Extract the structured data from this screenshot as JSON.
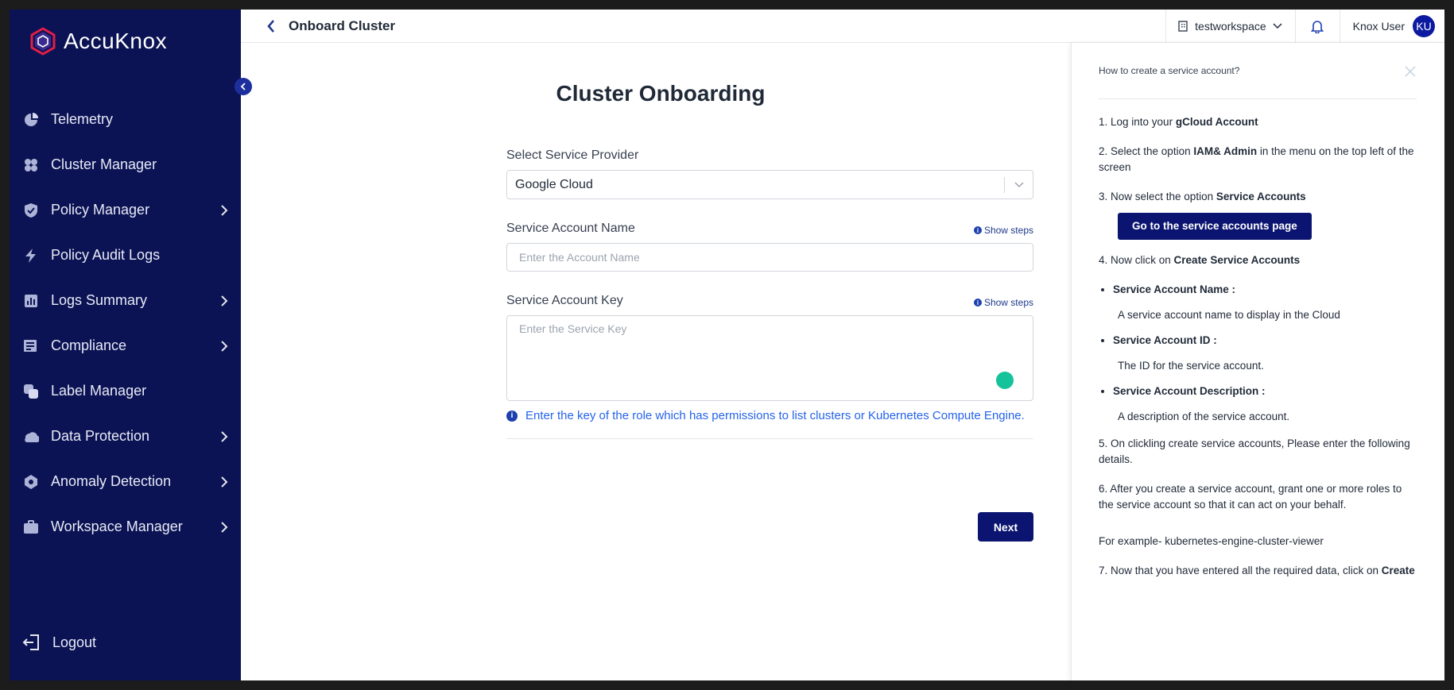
{
  "brand": {
    "name": "AccuKnox"
  },
  "sidebar": {
    "items": [
      {
        "label": "Telemetry",
        "icon": "telemetry-icon",
        "has_children": false
      },
      {
        "label": "Cluster Manager",
        "icon": "cluster-icon",
        "has_children": false
      },
      {
        "label": "Policy Manager",
        "icon": "shield-icon",
        "has_children": true
      },
      {
        "label": "Policy Audit Logs",
        "icon": "bolt-icon",
        "has_children": false
      },
      {
        "label": "Logs Summary",
        "icon": "bar-chart-icon",
        "has_children": true
      },
      {
        "label": "Compliance",
        "icon": "list-check-icon",
        "has_children": true
      },
      {
        "label": "Label Manager",
        "icon": "label-icon",
        "has_children": false
      },
      {
        "label": "Data Protection",
        "icon": "data-protection-icon",
        "has_children": true
      },
      {
        "label": "Anomaly Detection",
        "icon": "anomaly-icon",
        "has_children": true
      },
      {
        "label": "Workspace Manager",
        "icon": "briefcase-icon",
        "has_children": true
      }
    ],
    "logout_label": "Logout"
  },
  "header": {
    "title": "Onboard Cluster",
    "workspace": "testworkspace",
    "user_name": "Knox User",
    "user_initials": "KU"
  },
  "main": {
    "title": "Cluster Onboarding",
    "provider_label": "Select Service Provider",
    "provider_value": "Google Cloud",
    "account_name_label": "Service Account Name",
    "account_name_placeholder": "Enter the Account Name",
    "account_key_label": "Service Account Key",
    "account_key_placeholder": "Enter the Service Key",
    "show_steps": "Show steps",
    "hint": "Enter the key of the role which has permissions to list clusters or Kubernetes Compute Engine.",
    "next_label": "Next"
  },
  "help": {
    "title": "How to create a service account?",
    "step1_pre": "1. Log into your ",
    "step1_bold": "gCloud Account",
    "step2_pre": "2. Select the option ",
    "step2_bold": "IAM& Admin",
    "step2_post": " in the menu on the top left of the screen",
    "step3_pre": "3. Now select the option ",
    "step3_bold": "Service Accounts",
    "goto_button": "Go to the service accounts page",
    "step4_pre": "4. Now click on ",
    "step4_bold": "Create Service Accounts",
    "bullets": [
      {
        "title": "Service Account Name :",
        "desc": "A service account name to display in the Cloud"
      },
      {
        "title": "Service Account ID :",
        "desc": "The ID for the service account."
      },
      {
        "title": "Service Account Description :",
        "desc": "A description of the service account."
      }
    ],
    "step5": "5. On clickling create service accounts, Please enter the following details.",
    "step6": "6. After you create a service account, grant one or more roles to the service account so that it can act on your behalf.",
    "example": "For example- kubernetes-engine-cluster-viewer",
    "step7_pre": "7. Now that you have entered all the required data, click on ",
    "step7_bold": "Create"
  },
  "colors": {
    "sidebar_bg": "#0b1354",
    "primary_button": "#0b1470",
    "link": "#2563eb",
    "avatar": "#0b1aa0"
  }
}
